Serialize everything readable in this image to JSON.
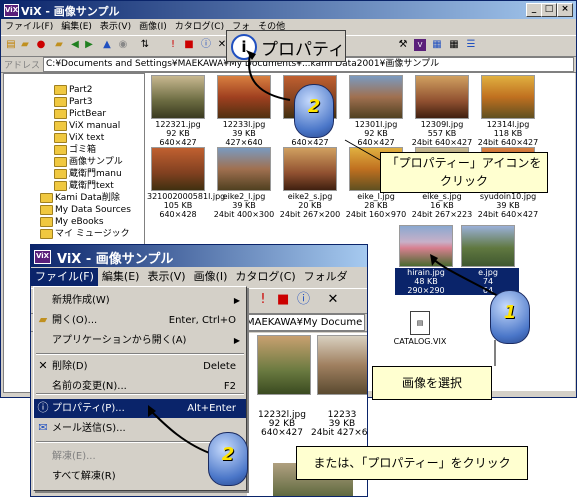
{
  "back_window": {
    "title": "ViX - 画像サンプル",
    "menus": [
      "ファイル(F)",
      "編集(E)",
      "表示(V)",
      "画像(I)",
      "カタログ(C)",
      "フォ",
      "その他"
    ],
    "address_label": "アドレス",
    "address_value": "C:¥Documents and Settings¥MAEKAWA¥My Documents¥...kami Data2001¥画像サンプル",
    "tree_items": [
      "Part2",
      "Part3",
      "PictBear",
      "ViX manual",
      "ViX text",
      "ゴミ箱",
      "画像サンプル",
      "蔵衛門manu",
      "蔵衛門text",
      "Kami Data削除",
      "My Data Sources",
      "My eBooks",
      "マイ ミュージック"
    ],
    "thumbs_row1": [
      {
        "name": "122321.jpg",
        "size": "92 KB",
        "dim": "640×427"
      },
      {
        "name": "12233l.jpg",
        "size": "39 KB",
        "dim": "427×640"
      },
      {
        "name": "124",
        "size": "98",
        "dim": "640×427"
      },
      {
        "name": "12301l.jpg",
        "size": "92 KB",
        "dim": "640×427"
      },
      {
        "name": "12309l.jpg",
        "size": "557 KB",
        "dim": "24bit 640×427"
      },
      {
        "name": "12314l.jpg",
        "size": "118 KB",
        "dim": "24bit 640×427"
      }
    ],
    "thumbs_row2": [
      {
        "name": "321002000581l.jpg",
        "size": "105 KB",
        "dim": "640×428"
      },
      {
        "name": "eike2_l.jpg",
        "size": "39 KB",
        "dim": "24bit 400×300"
      },
      {
        "name": "eike2_s.jpg",
        "size": "20 KB",
        "dim": "24bit 267×200"
      },
      {
        "name": "eike_l.jpg",
        "size": "28 KB",
        "dim": "24bit 160×970"
      },
      {
        "name": "eike_s.jpg",
        "size": "16 KB",
        "dim": "24bit 267×223"
      },
      {
        "name": "syudoin10.jpg",
        "size": "39 KB",
        "dim": "24bit 640×427"
      }
    ],
    "thumbs_row3": [
      {
        "name": "hirain.jpg",
        "size": "48 KB",
        "dim": "290×290"
      },
      {
        "name": "e.jpg",
        "size": "74",
        "dim": "64"
      }
    ],
    "catalog_label": "CATALOG.VIX"
  },
  "properties_callout": {
    "label": "プロパティ"
  },
  "front_window": {
    "title": "ViX - 画像サンプル",
    "menus": [
      "ファイル(F)",
      "編集(E)",
      "表示(V)",
      "画像(I)",
      "カタログ(C)",
      "フォルダ"
    ],
    "address_value": "MAEKAWA¥My Docume",
    "thumbs": [
      {
        "name": "12232l.jpg",
        "size": "92 KB",
        "dim": "640×427"
      },
      {
        "name": "12233",
        "size": "39 KB",
        "dim": "24bit 427×640"
      }
    ],
    "left_fragments": [
      "jpg",
      "KB",
      "40"
    ]
  },
  "file_menu": {
    "items": [
      {
        "label": "新規作成(W)",
        "shortcut": "",
        "submenu": true,
        "icon": "",
        "disabled": false
      },
      {
        "label": "開く(O)...",
        "shortcut": "Enter, Ctrl+O",
        "submenu": false,
        "icon": "open-folder-icon",
        "disabled": false
      },
      {
        "label": "アプリケーションから開く(A)",
        "shortcut": "",
        "submenu": true,
        "icon": "",
        "disabled": false
      },
      {
        "label": "削除(D)",
        "shortcut": "Delete",
        "submenu": false,
        "icon": "delete-x-icon",
        "disabled": false
      },
      {
        "label": "名前の変更(N)...",
        "shortcut": "F2",
        "submenu": false,
        "icon": "",
        "disabled": false
      },
      {
        "label": "プロパティ(P)...",
        "shortcut": "Alt+Enter",
        "submenu": false,
        "icon": "info-icon",
        "disabled": false
      },
      {
        "label": "メール送信(S)...",
        "shortcut": "",
        "submenu": false,
        "icon": "mail-icon",
        "disabled": false
      },
      {
        "label": "解凍(E)...",
        "shortcut": "",
        "submenu": false,
        "icon": "",
        "disabled": true
      },
      {
        "label": "すべて解凍(R)",
        "shortcut": "",
        "submenu": false,
        "icon": "",
        "disabled": false
      }
    ]
  },
  "annotations": {
    "properties_icon": "「プロパティー」アイコンをクリック",
    "select_image": "画像を選択",
    "or_properties": "または、「プロパティー」をクリック"
  },
  "mouse_steps": [
    "2",
    "1",
    "2"
  ],
  "colors": {
    "titlebar": "#0a246a",
    "highlight": "#0a246a",
    "callout_bg": "#ffffd0",
    "face": "#d4d0c8"
  }
}
